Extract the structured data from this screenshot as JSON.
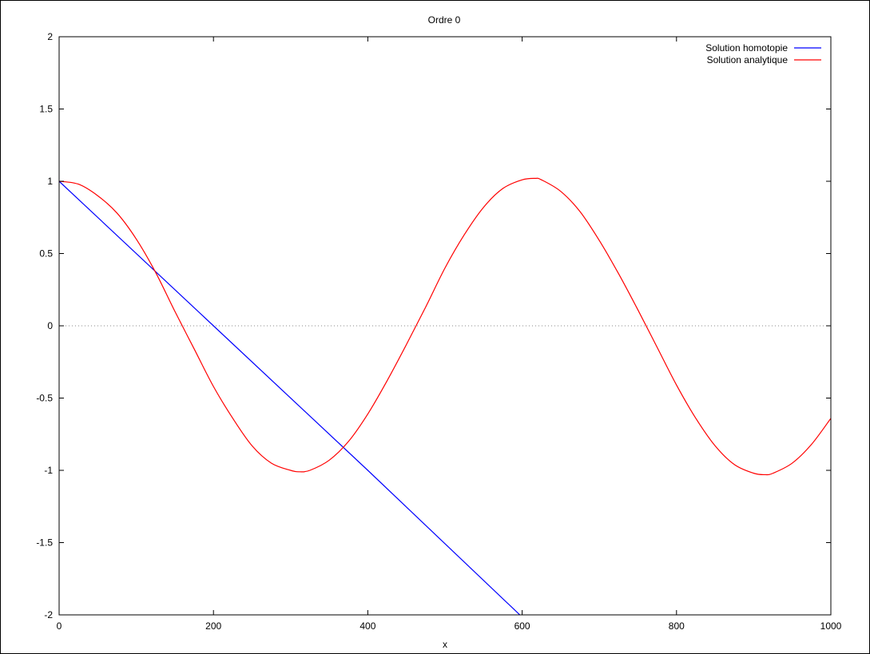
{
  "chart_data": {
    "type": "line",
    "title": "Ordre 0",
    "xlabel": "x",
    "ylabel": "",
    "xlim": [
      0,
      1000
    ],
    "ylim": [
      -2,
      2
    ],
    "x_ticks": [
      0,
      200,
      400,
      600,
      800,
      1000
    ],
    "y_ticks": [
      -2,
      -1.5,
      -1,
      -0.5,
      0,
      0.5,
      1,
      1.5,
      2
    ],
    "x_tick_labels": [
      "0",
      "200",
      "400",
      "600",
      "800",
      "1000"
    ],
    "y_tick_labels": [
      "-2",
      "-1.5",
      "-1",
      "-0.5",
      "0",
      "0.5",
      "1",
      "1.5",
      "2"
    ],
    "zero_line": true,
    "grid": false,
    "legend_position": "top-right",
    "series": [
      {
        "name": "Solution homotopie",
        "color": "#0000ff",
        "x": [
          0,
          200,
          400,
          597
        ],
        "y": [
          1,
          0,
          -1,
          -2
        ]
      },
      {
        "name": "Solution analytique",
        "color": "#ff0000",
        "x": [
          0,
          25,
          50,
          75,
          100,
          125,
          150,
          175,
          200,
          225,
          250,
          275,
          300,
          312,
          325,
          350,
          375,
          400,
          425,
          450,
          475,
          500,
          525,
          550,
          575,
          600,
          617,
          625,
          650,
          675,
          700,
          725,
          750,
          775,
          800,
          825,
          850,
          875,
          900,
          915,
          925,
          950,
          975,
          1000
        ],
        "y": [
          1.0,
          0.98,
          0.9,
          0.78,
          0.6,
          0.37,
          0.1,
          -0.16,
          -0.42,
          -0.64,
          -0.83,
          -0.95,
          -1.0,
          -1.01,
          -1.0,
          -0.93,
          -0.8,
          -0.61,
          -0.38,
          -0.13,
          0.13,
          0.4,
          0.63,
          0.82,
          0.95,
          1.01,
          1.02,
          1.01,
          0.93,
          0.79,
          0.59,
          0.36,
          0.11,
          -0.15,
          -0.41,
          -0.64,
          -0.83,
          -0.96,
          -1.02,
          -1.03,
          -1.02,
          -0.95,
          -0.82,
          -0.64
        ]
      }
    ]
  }
}
